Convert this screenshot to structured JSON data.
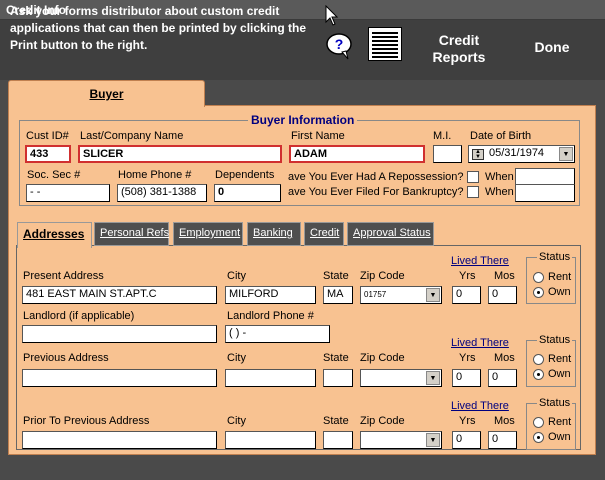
{
  "window": {
    "title": "Credit Info"
  },
  "header": {
    "message": "Ask your forms distributor about custom credit applications that can then be printed by clicking the Print button to the right.",
    "help_icon": "question-bubble-icon",
    "print_icon": "print-page-icon",
    "credit_reports_label": "Credit Reports",
    "done_label": "Done"
  },
  "tabs_top": {
    "buyer": "Buyer"
  },
  "buyer_info": {
    "title": "Buyer Information",
    "cust_id_label": "Cust ID#",
    "cust_id": "433",
    "company_label": "Last/Company Name",
    "company": "SLICER",
    "first_label": "First Name",
    "first": "ADAM",
    "mi_label": "M.I.",
    "mi": "",
    "dob_label": "Date of Birth",
    "dob": "05/31/1974",
    "ssn_label": "Soc. Sec #",
    "ssn": " -  -",
    "home_phone_label": "Home Phone #",
    "home_phone": "(508) 381-1388",
    "dependents_label": "Dependents",
    "dependents": "0",
    "repo_q": "ave You Ever Had A Repossession?",
    "bankrupt_q": "ave You Ever Filed For Bankruptcy?",
    "when_label": "When"
  },
  "tabs_sub": [
    "Addresses",
    "Personal Refs",
    "Employment",
    "Banking",
    "Credit",
    "Approval Status"
  ],
  "addresses": {
    "present_label": "Present Address",
    "present": "481 EAST MAIN ST.APT.C",
    "city_label": "City",
    "state_label": "State",
    "zip_label": "Zip Code",
    "lived_label": "Lived There",
    "yrs_label": "Yrs",
    "mos_label": "Mos",
    "status_label": "Status",
    "rent_label": "Rent",
    "own_label": "Own",
    "present_city": "MILFORD",
    "present_state": "MA",
    "present_zip": "01757",
    "present_yrs": "0",
    "present_mos": "0",
    "landlord_label": "Landlord (if applicable)",
    "landlord_phone_label": "Landlord Phone #",
    "landlord_phone": "(   )    -",
    "previous_label": "Previous Address",
    "previous_yrs": "0",
    "previous_mos": "0",
    "prior_label": "Prior To Previous Address",
    "prior_yrs": "0",
    "prior_mos": "0"
  }
}
